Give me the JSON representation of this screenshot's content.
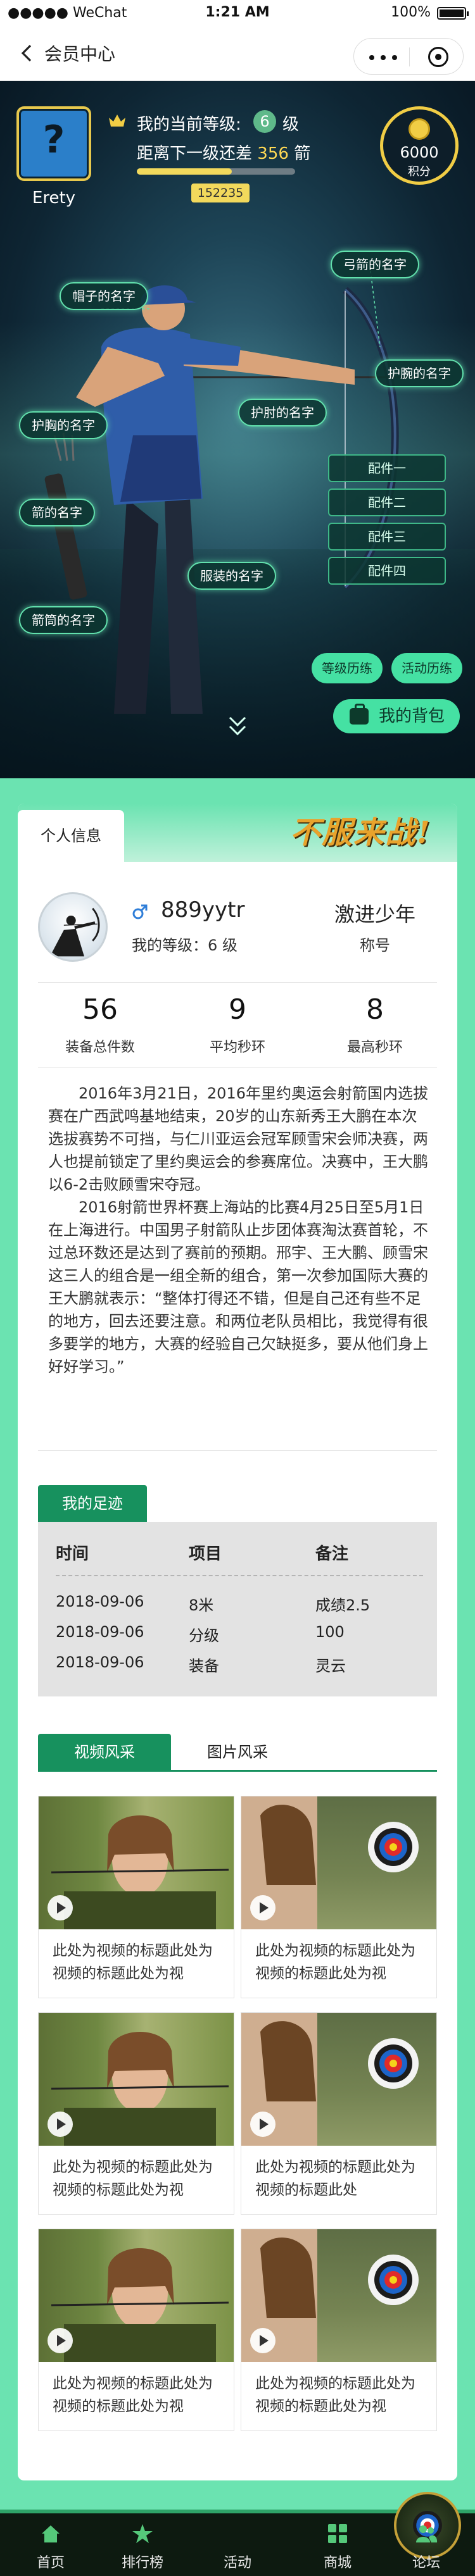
{
  "status_bar": {
    "carrier": "●●●●● WeChat",
    "time": "1:21 AM",
    "battery": "100%"
  },
  "nav": {
    "title": "会员中心"
  },
  "hero": {
    "avatar_symbol": "?",
    "user_name": "Erety",
    "level_prefix": "我的当前等级:",
    "level": "6",
    "level_unit": "级",
    "next_prefix": "距离下一级还差",
    "next_value": "356",
    "next_unit": "箭",
    "progress_fraction": 0.6,
    "progress_tag": "152235",
    "coins_value": "6000",
    "coins_unit": "积分",
    "labels": {
      "hat": "帽子的名字",
      "bow": "弓箭的名字",
      "guard": "护腕的名字",
      "armguard_right": "护肘的名字",
      "armguard_left": "护胸的名字",
      "arrow": "箭的名字",
      "clothes": "服装的名字",
      "quiver": "箭筒的名字"
    },
    "parts": [
      "配件一",
      "配件二",
      "配件三",
      "配件四"
    ],
    "buttons": {
      "level_history": "等级历练",
      "activity_history": "活动历练",
      "backpack": "我的背包"
    }
  },
  "card": {
    "tab_label": "个人信息",
    "slogan": "不服来战!",
    "profile": {
      "name": "889yytr",
      "level_text": "我的等级：6 级",
      "title_value": "激进少年",
      "title_label": "称号"
    },
    "stats": [
      {
        "value": "56",
        "label": "装备总件数"
      },
      {
        "value": "9",
        "label": "平均秒环"
      },
      {
        "value": "8",
        "label": "最高秒环"
      }
    ],
    "article": [
      "2016年3月21日，2016年里约奥运会射箭国内选拔赛在广西武鸣基地结束，20岁的山东新秀王大鹏在本次选拔赛势不可挡，与仁川亚运会冠军顾雪宋会师决赛，两人也提前锁定了里约奥运会的参赛席位。决赛中，王大鹏以6-2击败顾雪宋夺冠。",
      "2016射箭世界杯赛上海站的比赛4月25日至5月1日在上海进行。中国男子射箭队止步团体赛淘汰赛首轮，不过总环数还是达到了赛前的预期。邢宇、王大鹏、顾雪宋这三人的组合是一组全新的组合，第一次参加国际大赛的王大鹏就表示：“整体打得还不错，但是自己还有些不足的地方，回去还要注意。和两位老队员相比，我觉得有很多要学的地方，大赛的经验自己欠缺挺多，要从他们身上好好学习。”"
    ],
    "track": {
      "section_label": "我的足迹",
      "headers": [
        "时间",
        "项目",
        "备注"
      ],
      "rows": [
        [
          "2018-09-06",
          "8米",
          "成绩2.5"
        ],
        [
          "2018-09-06",
          "分级",
          "100"
        ],
        [
          "2018-09-06",
          "装备",
          "灵云"
        ]
      ]
    },
    "media": {
      "tabs": [
        "视频风采",
        "图片风采"
      ],
      "videos": [
        {
          "title": "此处为视频的标题此处为视频的标题此处为视",
          "thumb": "archer"
        },
        {
          "title": "此处为视频的标题此处为视频的标题此处为视",
          "thumb": "target"
        },
        {
          "title": "此处为视频的标题此处为视频的标题此处为视",
          "thumb": "archer"
        },
        {
          "title": "此处为视频的标题此处为视频的标题此处",
          "thumb": "target"
        },
        {
          "title": "此处为视频的标题此处为视频的标题此处为视",
          "thumb": "archer"
        },
        {
          "title": "此处为视频的标题此处为视频的标题此处为视",
          "thumb": "target"
        }
      ]
    }
  },
  "tabbar": {
    "items": [
      {
        "label": "首页",
        "icon": "home-icon"
      },
      {
        "label": "排行榜",
        "icon": "star-icon"
      },
      {
        "label": "活动",
        "icon": "target-icon"
      },
      {
        "label": "商城",
        "icon": "grid-icon"
      },
      {
        "label": "论坛",
        "icon": "people-icon"
      }
    ]
  },
  "colors": {
    "accent": "#45e1a3",
    "dark_green": "#17915e",
    "gold": "#f1cd45",
    "hero_bg": "#0e2533"
  }
}
